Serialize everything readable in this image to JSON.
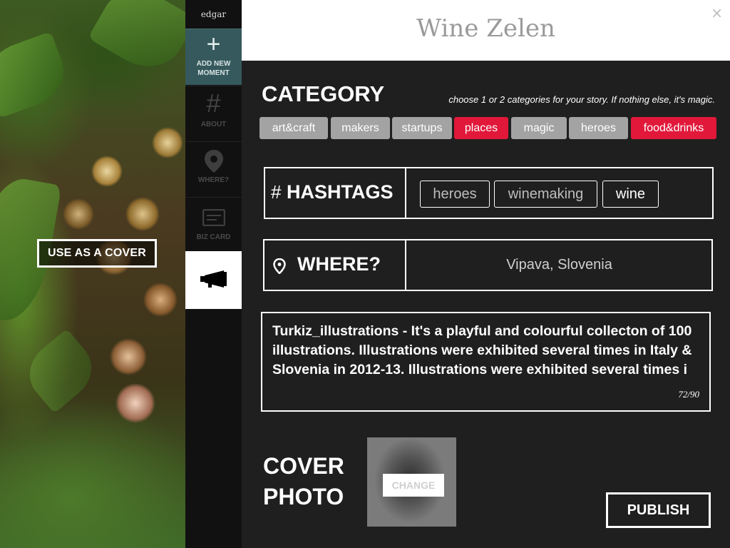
{
  "cover_action": {
    "label": "USE AS A COVER"
  },
  "sidebar": {
    "logo": "edgar",
    "items": [
      {
        "label_line1": "ADD NEW",
        "label_line2": "MOMENT",
        "icon": "plus-icon"
      },
      {
        "label": "ABOUT",
        "icon": "hash-icon"
      },
      {
        "label": "WHERE?",
        "icon": "location-pin-icon"
      },
      {
        "label": "BIZ CARD",
        "icon": "card-icon"
      },
      {
        "label": "",
        "icon": "megaphone-icon",
        "active": true
      }
    ]
  },
  "header": {
    "title": "Wine Zelen",
    "close": "×"
  },
  "category": {
    "title": "CATEGORY",
    "hint": "choose 1 or 2 categories for your story. If nothing else, it's magic.",
    "chips": [
      {
        "label": "art&craft",
        "selected": false
      },
      {
        "label": "makers",
        "selected": false
      },
      {
        "label": "startups",
        "selected": false
      },
      {
        "label": "places",
        "selected": true
      },
      {
        "label": "magic",
        "selected": false
      },
      {
        "label": "heroes",
        "selected": false
      },
      {
        "label": "food&drinks",
        "selected": true
      }
    ]
  },
  "hashtags": {
    "hash": "#",
    "title": "HASHTAGS",
    "tags": [
      {
        "label": "heroes"
      },
      {
        "label": "winemaking"
      },
      {
        "label": "wine",
        "active": true
      }
    ]
  },
  "where": {
    "title": "WHERE?",
    "value": "Vipava, Slovenia"
  },
  "description": {
    "text": "Turkiz_illustrations - It's a playful and colourful collecton of 100 illustrations. Illustrations were exhibited several times in Italy & Slovenia in 2012-13. Illustrations were exhibited several times i",
    "counter": "72/90"
  },
  "cover_photo": {
    "title_line1": "COVER",
    "title_line2": "PHOTO",
    "change_label": "CHANGE"
  },
  "publish": {
    "label": "PUBLISH"
  },
  "colors": {
    "selected_chip": "#e1183a",
    "chip": "#a3a3a3",
    "active_nav": "#35595c",
    "panel_bg": "#1f1f1f"
  }
}
